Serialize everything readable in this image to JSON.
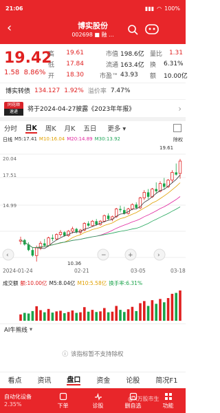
{
  "status": {
    "time": "21:06",
    "battery": "100%"
  },
  "header": {
    "title": "博实股份",
    "subtitle": "002698 ■ 融 ..."
  },
  "quote": {
    "price": "19.42",
    "change": "1.58",
    "change_pct": "8.86%",
    "rows": [
      {
        "l1": "高",
        "v1": "19.61",
        "l2": "市值",
        "v2": "198.6亿",
        "l3": "量比",
        "v3": "1.31"
      },
      {
        "l1": "低",
        "v1": "17.84",
        "l2": "流通",
        "v2": "163.4亿",
        "l3": "换",
        "v3": "6.31%"
      },
      {
        "l1": "开",
        "v1": "18.30",
        "l2": "市盈™",
        "v2": "43.93",
        "l3": "额",
        "v3": "10.00亿"
      }
    ]
  },
  "bond": {
    "label": "博实转债",
    "price": "134.127",
    "pct": "1.92%",
    "premium_label": "溢价率",
    "premium": "7.47%"
  },
  "notice": {
    "logo_top": "同花顺",
    "logo_bottom": "速递",
    "text": "将于2024-04-27披露《2023年年报》"
  },
  "period_tabs": [
    "分时",
    "日K",
    "周K",
    "月K",
    "五日",
    "更多"
  ],
  "active_tab": "日K",
  "ma": {
    "label": "日线",
    "m5": "M5:17.41",
    "m10": "M10:16.04",
    "m20": "M20:14.89",
    "m30": "M30:13.92",
    "rq": "除权"
  },
  "axis": {
    "y_top": "20.04",
    "y_mid": "17.51",
    "y_low": "14.99",
    "high_label": "19.61",
    "low_label": "10.36"
  },
  "dates": [
    "2024-01-24",
    "02-21",
    "03-05",
    "03-18"
  ],
  "vol": {
    "label": "成交额",
    "e": "额:10.00亿",
    "m5": "M5:8.04亿",
    "m10": "M10:5.58亿",
    "turnover": "换手率:6.31%"
  },
  "ai": {
    "label": "AI牛熊线",
    "empty": "该指标暂不支持除权"
  },
  "bottom_tabs": [
    "看点",
    "资讯",
    "盘口",
    "资金",
    "论股",
    "简况F1"
  ],
  "active_bottom": "盘口",
  "actions": {
    "group": "自动化设备",
    "group_pct": "2.35%",
    "items": [
      "下单",
      "诊股",
      "删自选",
      "功能"
    ]
  },
  "watermark": "@X万股市生",
  "colors": {
    "brand": "#e8262a",
    "up": "#e02020",
    "down": "#1aa34a"
  },
  "chart_data": {
    "type": "candlestick",
    "x_start": "2024-01-24",
    "x_end": "03-18",
    "ylim": [
      10.36,
      20.04
    ],
    "candles": [
      [
        12.2,
        12.6,
        11.9,
        12.3
      ],
      [
        12.3,
        12.4,
        11.8,
        11.9
      ],
      [
        11.9,
        12.1,
        11.3,
        11.4
      ],
      [
        11.4,
        11.6,
        10.8,
        10.9
      ],
      [
        10.9,
        11.8,
        10.36,
        11.6
      ],
      [
        11.6,
        12.2,
        11.4,
        12.0
      ],
      [
        12.0,
        12.4,
        11.7,
        11.8
      ],
      [
        11.8,
        12.6,
        11.7,
        12.5
      ],
      [
        12.5,
        12.8,
        12.2,
        12.4
      ],
      [
        12.4,
        12.9,
        12.3,
        12.8
      ],
      [
        12.8,
        13.2,
        12.6,
        13.0
      ],
      [
        13.0,
        13.1,
        12.6,
        12.7
      ],
      [
        12.7,
        13.2,
        12.6,
        13.1
      ],
      [
        13.1,
        13.5,
        12.9,
        13.3
      ],
      [
        13.3,
        13.4,
        12.9,
        13.0
      ],
      [
        13.0,
        13.3,
        12.8,
        13.2
      ],
      [
        13.2,
        13.9,
        13.1,
        13.8
      ],
      [
        13.8,
        14.0,
        13.5,
        13.6
      ],
      [
        13.6,
        14.1,
        13.5,
        14.0
      ],
      [
        14.0,
        14.2,
        13.6,
        13.7
      ],
      [
        13.7,
        14.1,
        13.6,
        14.0
      ],
      [
        14.0,
        14.6,
        13.9,
        14.5
      ],
      [
        14.5,
        14.7,
        14.1,
        14.2
      ],
      [
        14.2,
        14.5,
        14.0,
        14.4
      ],
      [
        14.4,
        15.2,
        14.3,
        15.1
      ],
      [
        15.1,
        15.4,
        14.8,
        15.0
      ],
      [
        15.0,
        15.3,
        14.6,
        14.7
      ],
      [
        14.7,
        15.2,
        14.6,
        15.1
      ],
      [
        15.1,
        15.6,
        15.0,
        15.5
      ],
      [
        15.5,
        15.7,
        15.1,
        15.2
      ],
      [
        15.2,
        16.2,
        15.1,
        16.1
      ],
      [
        16.1,
        16.8,
        15.9,
        16.6
      ],
      [
        16.6,
        16.9,
        16.0,
        16.2
      ],
      [
        16.2,
        17.0,
        16.1,
        16.9
      ],
      [
        16.9,
        17.5,
        16.5,
        16.7
      ],
      [
        16.7,
        17.6,
        16.6,
        17.4
      ],
      [
        17.4,
        17.9,
        16.9,
        17.1
      ],
      [
        17.1,
        17.8,
        17.0,
        17.7
      ],
      [
        17.7,
        18.6,
        17.5,
        18.4
      ],
      [
        18.4,
        19.2,
        18.1,
        18.2
      ],
      [
        18.3,
        19.61,
        17.84,
        19.42
      ]
    ],
    "volumes": [
      2.1,
      2.6,
      2.4,
      3.2,
      4.8,
      3.5,
      2.8,
      3.9,
      2.7,
      3.1,
      3.3,
      2.5,
      2.9,
      3.4,
      2.6,
      2.8,
      4.5,
      3.0,
      3.6,
      2.9,
      3.1,
      4.2,
      2.8,
      3.0,
      4.9,
      3.6,
      2.9,
      3.8,
      4.6,
      3.2,
      5.8,
      6.5,
      4.9,
      6.8,
      5.6,
      7.2,
      6.1,
      7.5,
      8.9,
      9.2,
      10.0
    ]
  }
}
